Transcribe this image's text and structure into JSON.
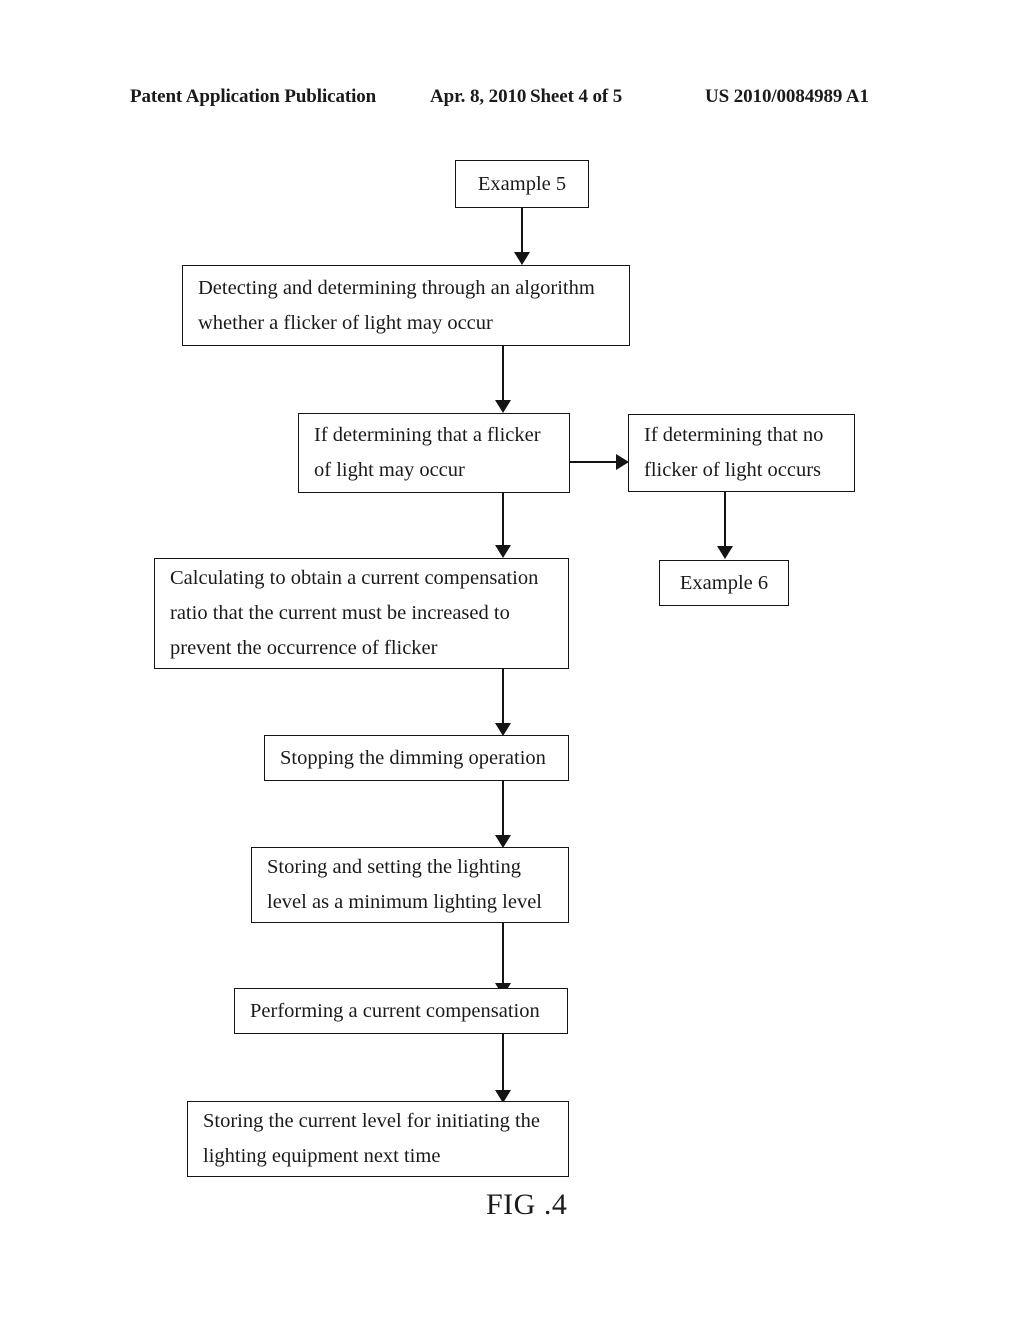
{
  "header": {
    "publication": "Patent Application Publication",
    "date": "Apr. 8, 2010",
    "sheet": "Sheet 4 of 5",
    "patent_number": "US 2010/0084989 A1"
  },
  "figure": {
    "caption": "FIG .4",
    "nodes": {
      "example5": {
        "line1": "Example 5"
      },
      "detecting": {
        "line1": "Detecting and determining through an algorithm",
        "line2": "whether a flicker of light may occur"
      },
      "flicker_yes": {
        "line1": "If determining that a flicker",
        "line2": "of light may occur"
      },
      "flicker_no": {
        "line1": "If determining that no",
        "line2": "flicker of light occurs"
      },
      "calculating": {
        "line1": "Calculating to obtain a current compensation",
        "line2": "ratio that the current must be increased to",
        "line3": "prevent the occurrence of flicker"
      },
      "example6": {
        "line1": "Example 6"
      },
      "stopping": {
        "line1": "Stopping the dimming operation"
      },
      "storing_level": {
        "line1": "Storing and setting the lighting",
        "line2": "level as a minimum lighting level"
      },
      "performing": {
        "line1": "Performing a current compensation"
      },
      "storing_current": {
        "line1": "Storing the current level for initiating the",
        "line2": "lighting equipment next time"
      }
    }
  }
}
